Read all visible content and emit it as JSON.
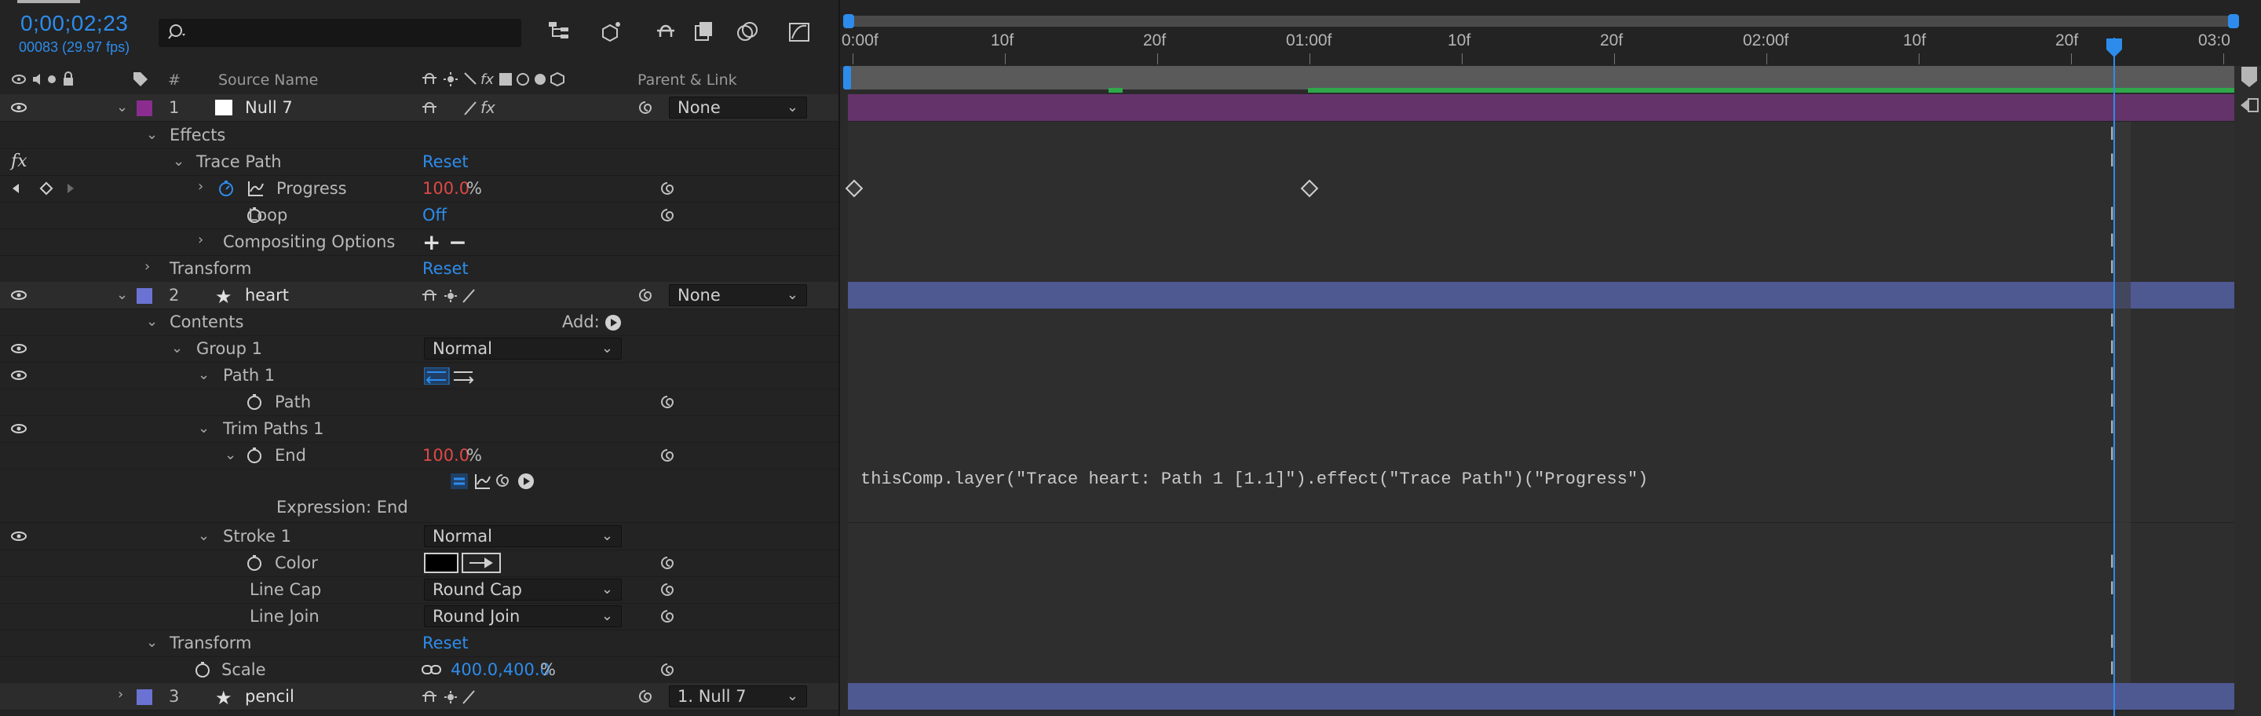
{
  "header": {
    "timecode": "0;00;02;23",
    "fps": "00083 (29.97 fps)",
    "search_placeholder": ""
  },
  "columns": {
    "num": "#",
    "source_name": "Source Name",
    "parent_link": "Parent & Link"
  },
  "ruler": {
    "labels": [
      "0:00f",
      "10f",
      "20f",
      "01:00f",
      "10f",
      "20f",
      "02:00f",
      "10f",
      "20f",
      "03:0"
    ]
  },
  "rows": [
    {
      "num": "1",
      "name": "Null 7",
      "parent": "None"
    },
    {
      "label": "Effects"
    },
    {
      "label": "Trace Path",
      "value": "Reset"
    },
    {
      "label": "Progress",
      "value": "100.0",
      "unit": "%"
    },
    {
      "label": "Loop",
      "value": "Off"
    },
    {
      "label": "Compositing Options",
      "value": "+ −"
    },
    {
      "label": "Transform",
      "value": "Reset"
    },
    {
      "num": "2",
      "name": "heart",
      "parent": "None"
    },
    {
      "label": "Contents",
      "add": "Add:"
    },
    {
      "label": "Group 1",
      "mode": "Normal"
    },
    {
      "label": "Path 1"
    },
    {
      "label": "Path"
    },
    {
      "label": "Trim Paths 1"
    },
    {
      "label": "End",
      "value": "100.0",
      "unit": "%"
    },
    {
      "label": "Expression: End"
    },
    {
      "label": "Stroke 1",
      "mode": "Normal"
    },
    {
      "label": "Color"
    },
    {
      "label": "Line Cap",
      "mode": "Round Cap"
    },
    {
      "label": "Line Join",
      "mode": "Round Join"
    },
    {
      "label": "Transform",
      "value": "Reset"
    },
    {
      "label": "Scale",
      "value": "400.0,400.0",
      "unit": "%"
    },
    {
      "num": "3",
      "name": "pencil",
      "parent": "1. Null 7"
    }
  ],
  "expression": "thisComp.layer(\"Trace heart: Path 1 [1.1]\").effect(\"Trace Path\")(\"Progress\")",
  "colors": {
    "accent": "#2d8ceb",
    "null_label": "#8a2d8f",
    "heart_label": "#6a73d4",
    "purple_bar": "#64336a",
    "blue_bar": "#4e5891",
    "green_bar": "#2fa84b"
  }
}
